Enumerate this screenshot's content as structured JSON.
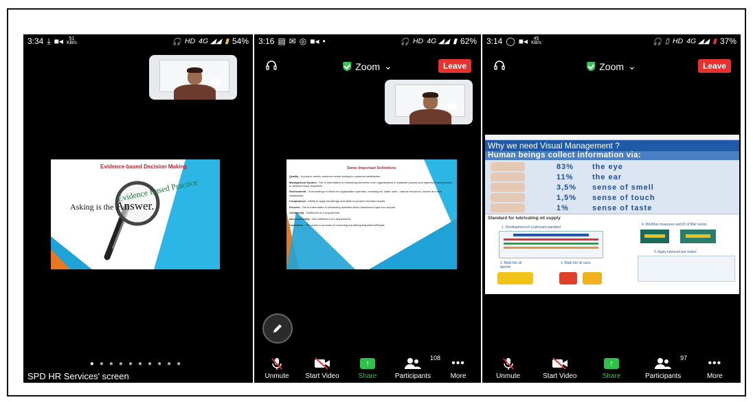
{
  "phones": [
    {
      "status": {
        "time": "3:34",
        "speed": "51",
        "speed_unit": "KB/s",
        "net": "HD",
        "battery": "54%"
      },
      "slide": {
        "title": "Evidence-based Decision Making",
        "arc_text": "Evidence Based Practice",
        "phrase": "Asking is the",
        "emph": "Answer."
      },
      "screen_label": "SPD HR Services' screen"
    },
    {
      "status": {
        "time": "3:16",
        "net": "HD",
        "battery": "62%"
      },
      "app_title": "Zoom",
      "leave_label": "Leave",
      "slide": {
        "title": "Some Important Definitions",
        "defs": [
          {
            "term": "Quality",
            "text": ": A product meets customer needs leading to customer satisfaction."
          },
          {
            "term": "Management System",
            "text": ": Set of interrelated or interacting elements of an organizations to establish policies and objectives and process to achieve those objectives."
          },
          {
            "term": "Environment",
            "text": ": Surroundings in which an organization operates, including air, water, land , natural resources, human and their relationship."
          },
          {
            "term": "Competence",
            "text": ": Ability to apply knowledge and skills to achieve intended results."
          },
          {
            "term": "Process",
            "text": ": Set of interrelated or interacting activities which transforms input into outputs."
          },
          {
            "term": "Conformity",
            "text": ": Fulfillment of a requirement."
          },
          {
            "term": "Non-conformity",
            "text": ": Non-fulfillment of a requirement."
          },
          {
            "term": "Correction",
            "text": ": The action or process of correcting something/Adjustment/Repair."
          }
        ]
      },
      "toolbar": {
        "mute": "Unmute",
        "video": "Start Video",
        "share": "Share",
        "participants": "Participants",
        "participants_count": "108",
        "more": "More"
      }
    },
    {
      "status": {
        "time": "3:14",
        "speed": "45",
        "speed_unit": "KB/s",
        "net": "HD",
        "battery": "37%"
      },
      "app_title": "Zoom",
      "leave_label": "Leave",
      "slide": {
        "heading": "Why we need Visual Management ?",
        "subheading": "Human beings collect information via:",
        "stats": [
          {
            "pct": "83%",
            "label": "the eye"
          },
          {
            "pct": "11%",
            "label": "the ear"
          },
          {
            "pct": "3,5%",
            "label": "sense of smell"
          },
          {
            "pct": "1,5%",
            "label": "sense of touch"
          },
          {
            "pct": "1%",
            "label": "sense of taste"
          }
        ],
        "lower_title": "Standard for lubricating oil supply",
        "step1": "1. Development of a lubricant standard",
        "step2": "2. Mark the oil barrels",
        "step3": "3. Mark the oil cans",
        "step4": "4. Min/Max measures and ID of filler necks",
        "step5": "5. Apply lubricant per matrix"
      },
      "toolbar": {
        "mute": "Unmute",
        "video": "Start Video",
        "share": "Share",
        "participants": "Participants",
        "participants_count": "97",
        "more": "More"
      }
    }
  ]
}
